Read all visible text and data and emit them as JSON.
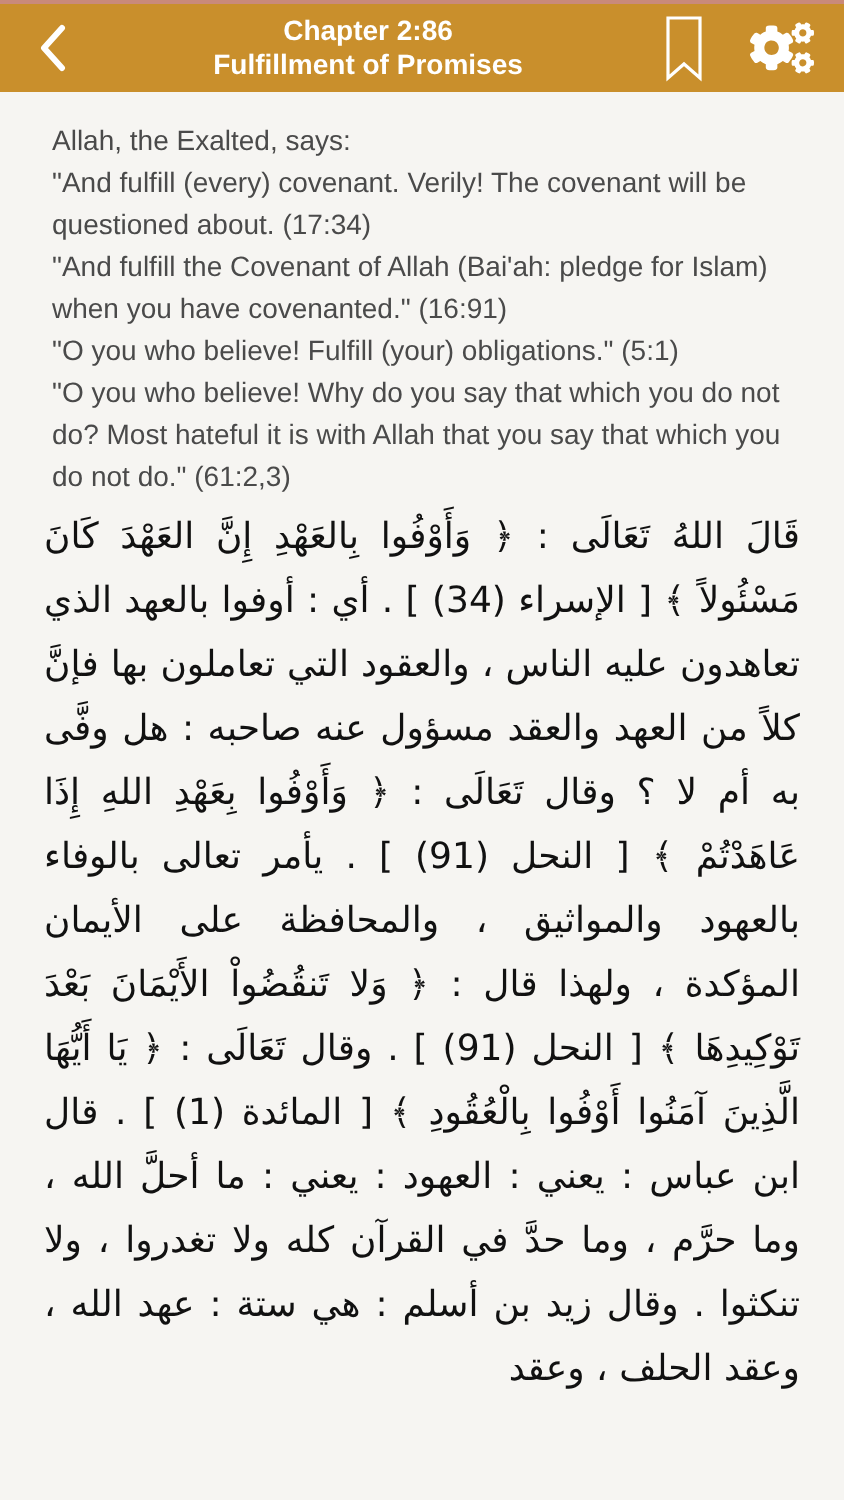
{
  "header": {
    "chapter": "Chapter 2:86",
    "title": "Fulfillment of Promises"
  },
  "english_lines": [
    "Allah, the Exalted, says:",
    "\"And fulfill (every) covenant. Verily! The covenant will be questioned about. (17:34)",
    "\"And fulfill the Covenant of Allah (Bai'ah: pledge for Islam) when you have covenanted.\" (16:91)",
    "\"O you who believe! Fulfill (your) obligations.\" (5:1)",
    "\"O you who believe! Why do you say that which you do not do? Most hateful it is with Allah that you say that which you do not do.\" (61:2,3)"
  ],
  "arabic_text": "قَالَ اللهُ تَعَالَى : ﴿ وَأَوْفُوا بِالعَهْدِ إِنَّ العَهْدَ كَانَ مَسْئُولاً ﴾ [ الإسراء (34) ] . أي : أوفوا بالعهد الذي تعاهدون عليه الناس ، والعقود التي تعاملون بها فإنَّ كلاً من العهد والعقد مسؤول عنه صاحبه : هل وفَّى به أم لا ؟ وقال تَعَالَى : ﴿ وَأَوْفُوا بِعَهْدِ اللهِ إِذَا عَاهَدْتُمْ ﴾ [ النحل (91) ] . يأمر تعالى بالوفاء بالعهود والمواثيق ، والمحافظة على الأيمان المؤكدة ، ولهذا قال : ﴿ وَلا تَنقُضُواْ الأَيْمَانَ بَعْدَ تَوْكِيدِهَا ﴾ [ النحل (91) ] . وقال تَعَالَى : ﴿ يَا أَيُّهَا الَّذِينَ آمَنُوا أَوْفُوا بِالْعُقُودِ ﴾ [ المائدة (1) ] . قال ابن عباس : يعني : العهود : يعني : ما أحلَّ الله ، وما حرَّم ، وما حدَّ في القرآن كله ولا تغدروا ، ولا تنكثوا . وقال زيد بن أسلم : هي ستة : عهد الله ، وعقد الحلف ، وعقد"
}
